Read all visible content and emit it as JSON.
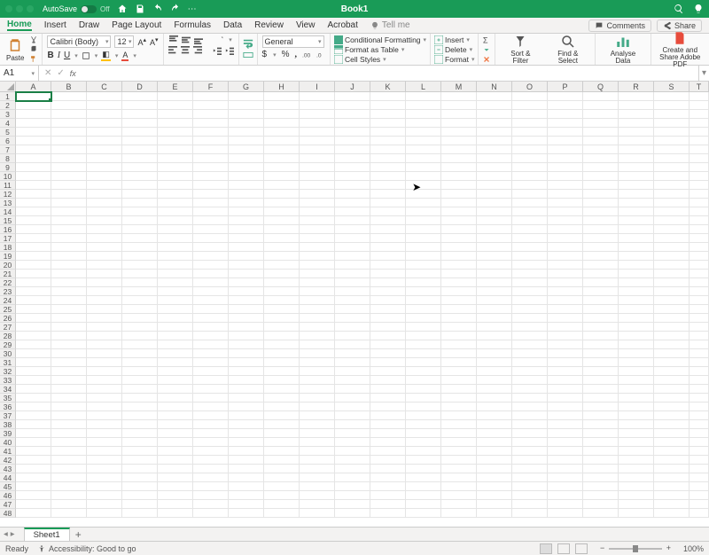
{
  "titlebar": {
    "autosave_label": "AutoSave",
    "autosave_state": "Off",
    "doc_title": "Book1"
  },
  "tabs": {
    "items": [
      "Home",
      "Insert",
      "Draw",
      "Page Layout",
      "Formulas",
      "Data",
      "Review",
      "View",
      "Acrobat"
    ],
    "active_index": 0,
    "tell_me": "Tell me",
    "comments": "Comments",
    "share": "Share"
  },
  "ribbon": {
    "paste": "Paste",
    "font_name": "Calibri (Body)",
    "font_size": "12",
    "number_format": "General",
    "cond_fmt": "Conditional Formatting",
    "fmt_table": "Format as Table",
    "cell_styles": "Cell Styles",
    "insert": "Insert",
    "delete": "Delete",
    "format": "Format",
    "sort_filter": "Sort & Filter",
    "find_select": "Find & Select",
    "analyse": "Analyse Data",
    "adobe": "Create and Share Adobe PDF",
    "currency": "$",
    "percent": "%",
    "comma": ","
  },
  "formula_bar": {
    "name_box": "A1",
    "formula": ""
  },
  "grid": {
    "columns": [
      "A",
      "B",
      "C",
      "D",
      "E",
      "F",
      "G",
      "H",
      "I",
      "J",
      "K",
      "L",
      "M",
      "N",
      "O",
      "P",
      "Q",
      "R",
      "S",
      "T"
    ],
    "row_count": 48,
    "selected_cell": "A1"
  },
  "sheets": {
    "active": "Sheet1"
  },
  "status": {
    "ready": "Ready",
    "accessibility": "Accessibility: Good to go",
    "zoom": "100%"
  }
}
